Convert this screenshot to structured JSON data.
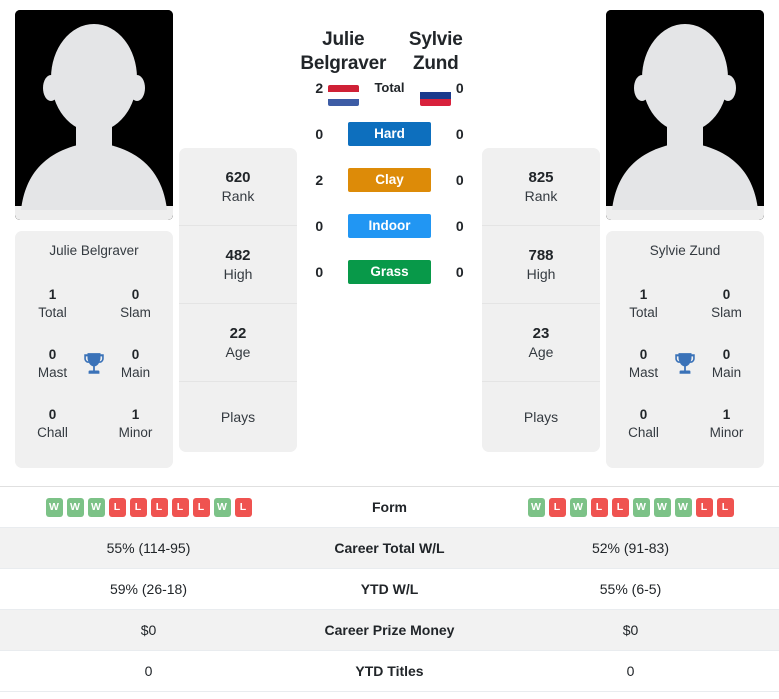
{
  "players": {
    "left": {
      "name_line1": "Julie",
      "name_line2": "Belgraver",
      "full_name": "Julie Belgraver",
      "photo_alt": "player-photo-placeholder",
      "flag": {
        "country": "Netherlands",
        "stripes": [
          "#cf2136",
          "#ffffff",
          "#3d5ca5"
        ]
      },
      "rank": "620",
      "rank_label": "Rank",
      "high": "482",
      "high_label": "High",
      "age": "22",
      "age_label": "Age",
      "plays": "",
      "plays_label": "Plays",
      "titles": {
        "total_num": "1",
        "total_label": "Total",
        "slam_num": "0",
        "slam_label": "Slam",
        "mast_num": "0",
        "mast_label": "Mast",
        "main_num": "0",
        "main_label": "Main",
        "chall_num": "0",
        "chall_label": "Chall",
        "minor_num": "1",
        "minor_label": "Minor"
      },
      "surface_scores": {
        "total": "2",
        "hard": "0",
        "clay": "2",
        "indoor": "0",
        "grass": "0"
      },
      "form": [
        "W",
        "W",
        "W",
        "L",
        "L",
        "L",
        "L",
        "L",
        "W",
        "L"
      ],
      "career_total_wl": "55% (114-95)",
      "ytd_wl": "59% (26-18)",
      "career_prize_money": "$0",
      "ytd_titles": "0"
    },
    "right": {
      "name_line1": "Sylvie Zund",
      "name_line2": "",
      "full_name": "Sylvie Zund",
      "photo_alt": "player-photo-placeholder",
      "flag": {
        "country": "Russia",
        "stripes": [
          "#ffffff",
          "#1b3a8c",
          "#d8213c"
        ]
      },
      "rank": "825",
      "rank_label": "Rank",
      "high": "788",
      "high_label": "High",
      "age": "23",
      "age_label": "Age",
      "plays": "",
      "plays_label": "Plays",
      "titles": {
        "total_num": "1",
        "total_label": "Total",
        "slam_num": "0",
        "slam_label": "Slam",
        "mast_num": "0",
        "mast_label": "Mast",
        "main_num": "0",
        "main_label": "Main",
        "chall_num": "0",
        "chall_label": "Chall",
        "minor_num": "1",
        "minor_label": "Minor"
      },
      "surface_scores": {
        "total": "0",
        "hard": "0",
        "clay": "0",
        "indoor": "0",
        "grass": "0"
      },
      "form": [
        "W",
        "L",
        "W",
        "L",
        "L",
        "W",
        "W",
        "W",
        "L",
        "L"
      ],
      "career_total_wl": "52% (91-83)",
      "ytd_wl": "55% (6-5)",
      "career_prize_money": "$0",
      "ytd_titles": "0"
    }
  },
  "surfaces": [
    {
      "key": "total",
      "label": "Total",
      "color": "transparent",
      "text_color": "#212529"
    },
    {
      "key": "hard",
      "label": "Hard",
      "color": "#0d6fbe",
      "text_color": "#ffffff"
    },
    {
      "key": "clay",
      "label": "Clay",
      "color": "#dd8b08",
      "text_color": "#ffffff"
    },
    {
      "key": "indoor",
      "label": "Indoor",
      "color": "#2196f3",
      "text_color": "#ffffff"
    },
    {
      "key": "grass",
      "label": "Grass",
      "color": "#089949",
      "text_color": "#ffffff"
    }
  ],
  "stats_table": {
    "rows": [
      {
        "label": "Form",
        "type": "form"
      },
      {
        "label": "Career Total W/L",
        "type": "text",
        "left": "55% (114-95)",
        "right": "52% (91-83)"
      },
      {
        "label": "YTD W/L",
        "type": "text",
        "left": "59% (26-18)",
        "right": "55% (6-5)"
      },
      {
        "label": "Career Prize Money",
        "type": "text",
        "left": "$0",
        "right": "$0"
      },
      {
        "label": "YTD Titles",
        "type": "text",
        "left": "0",
        "right": "0"
      }
    ]
  },
  "icons": {
    "trophy": "trophy-icon",
    "avatar": "person-silhouette-icon"
  },
  "colors": {
    "card_bg": "#f0f0f0",
    "row_shaded": "#f2f2f2",
    "win": "#7cc287",
    "loss": "#ef5350",
    "trophy": "#3a72b8"
  }
}
